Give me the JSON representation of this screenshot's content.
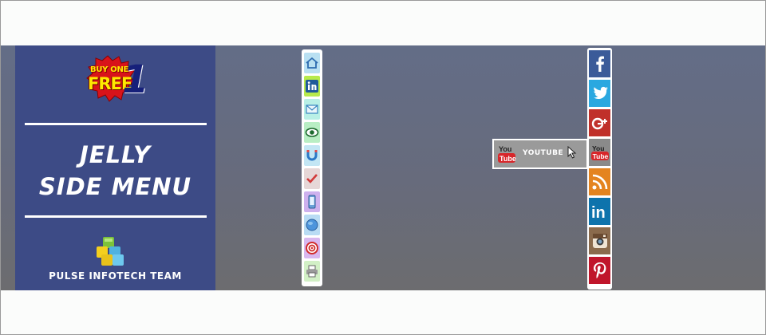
{
  "promo": {
    "logo_line1": "BUY ONE",
    "logo_line2": "FREE",
    "logo_number": "1",
    "title_line1": "JELLY",
    "title_line2": "SIDE MENU",
    "team": "PULSE INFOTECH TEAM"
  },
  "jelly_menu": {
    "items": [
      {
        "icon": "home-icon",
        "bg": "#b9e0f2"
      },
      {
        "icon": "linkedin-icon",
        "bg": "#b7ea4c"
      },
      {
        "icon": "mail-icon",
        "bg": "#b9f0e6"
      },
      {
        "icon": "eye-icon",
        "bg": "#b9eec4"
      },
      {
        "icon": "magnet-icon",
        "bg": "#c3e6f4"
      },
      {
        "icon": "check-icon",
        "bg": "#e6d7d7"
      },
      {
        "icon": "phone-icon",
        "bg": "#ceb1ee"
      },
      {
        "icon": "globe-icon",
        "bg": "#b9dcf4"
      },
      {
        "icon": "target-icon",
        "bg": "#d9b8f0"
      },
      {
        "icon": "print-icon",
        "bg": "#d2f0c6"
      }
    ]
  },
  "social_menu": {
    "items": [
      {
        "icon": "facebook-icon",
        "bg": "#3b5b99"
      },
      {
        "icon": "twitter-icon",
        "bg": "#2aa8e0"
      },
      {
        "icon": "google-plus-icon",
        "bg": "#c0302a"
      },
      {
        "icon": "youtube-icon",
        "bg": "#8a8a8a",
        "label": "You",
        "sub": "Tube"
      },
      {
        "icon": "rss-icon",
        "bg": "#e48420"
      },
      {
        "icon": "linkedin-icon",
        "bg": "#0e73ac",
        "label": "in"
      },
      {
        "icon": "instagram-icon",
        "bg": "#8a6a4c"
      },
      {
        "icon": "pinterest-icon",
        "bg": "#c0162b"
      }
    ]
  },
  "tooltip": {
    "label": "YOUTUBE",
    "icon_top": "You",
    "icon_bottom": "Tube"
  }
}
